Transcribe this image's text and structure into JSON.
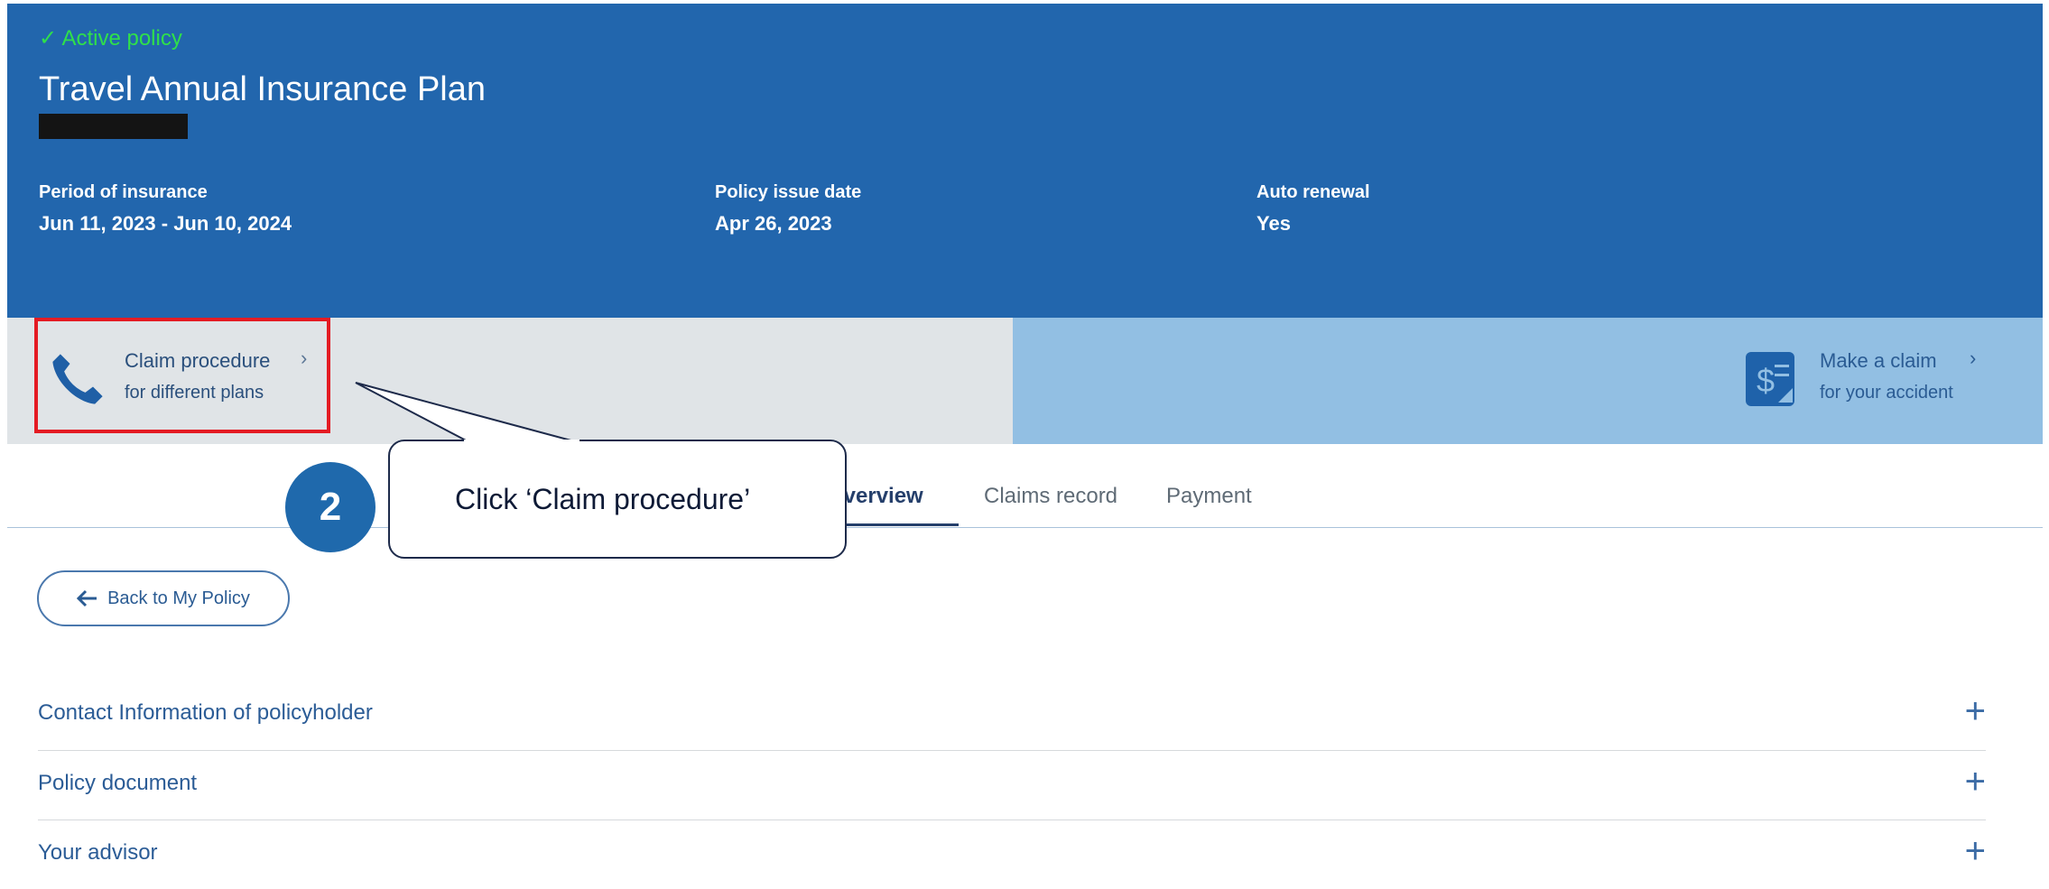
{
  "policy": {
    "status": "✓ Active policy",
    "title": "Travel Annual Insurance Plan",
    "fields": [
      {
        "label": "Period of insurance",
        "value": "Jun 11, 2023 - Jun 10, 2024"
      },
      {
        "label": "Policy issue date",
        "value": "Apr 26, 2023"
      },
      {
        "label": "Auto renewal",
        "value": "Yes"
      }
    ]
  },
  "claim_procedure": {
    "title": "Claim procedure",
    "subtitle": "for different plans",
    "icon": "phone-icon"
  },
  "make_claim": {
    "title": "Make a claim",
    "subtitle": "for your accident",
    "icon": "dollar-document-icon"
  },
  "tabs": [
    {
      "label": "overview",
      "active": true
    },
    {
      "label": "Claims record",
      "active": false
    },
    {
      "label": "Payment",
      "active": false
    }
  ],
  "back_button": "Back to My Policy",
  "accordion": [
    {
      "label": "Contact Information of policyholder"
    },
    {
      "label": "Policy document"
    },
    {
      "label": "Your advisor"
    }
  ],
  "callout": {
    "step": "2",
    "text": "Click ‘Claim procedure’"
  },
  "colors": {
    "header": "#2266ad",
    "active_green": "#2fe04a",
    "highlight_red": "#e41b23"
  }
}
